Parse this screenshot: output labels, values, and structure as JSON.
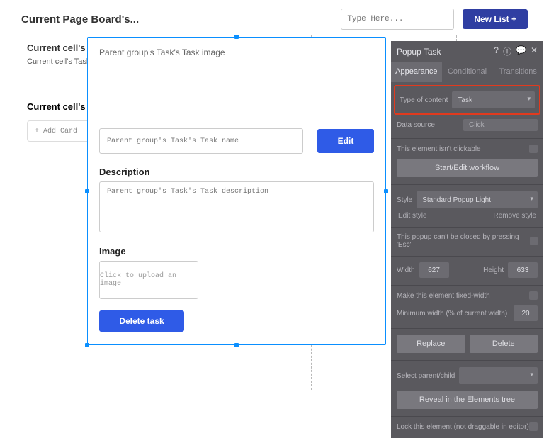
{
  "header": {
    "title": "Current Page Board's...",
    "type_placeholder": "Type Here...",
    "new_list_label": "New List +"
  },
  "board": {
    "col_header": "Current cell's I",
    "task_label": "Current cell's Task",
    "col_sub": "Current cell's",
    "add_card": "+ Add Card"
  },
  "popup": {
    "image_label": "Parent group's Task's Task image",
    "name_placeholder": "Parent group's Task's Task name",
    "edit_label": "Edit",
    "desc_heading": "Description",
    "desc_placeholder": "Parent group's Task's Task description",
    "image_heading": "Image",
    "image_upload": "Click to upload an image",
    "delete_label": "Delete task"
  },
  "inspector": {
    "title": "Popup Task",
    "tabs": {
      "appearance": "Appearance",
      "conditional": "Conditional",
      "transitions": "Transitions"
    },
    "type_of_content_label": "Type of content",
    "type_of_content_value": "Task",
    "data_source_label": "Data source",
    "data_source_value": "Click",
    "not_clickable": "This element isn't clickable",
    "workflow_btn": "Start/Edit workflow",
    "style_label": "Style",
    "style_value": "Standard Popup Light",
    "edit_style": "Edit style",
    "remove_style": "Remove style",
    "esc_note": "This popup can't be closed by pressing 'Esc'",
    "width_label": "Width",
    "width_value": "627",
    "height_label": "Height",
    "height_value": "633",
    "fixed_width": "Make this element fixed-width",
    "min_width_label": "Minimum width (% of current width)",
    "min_width_value": "20",
    "replace": "Replace",
    "delete": "Delete",
    "select_parent": "Select parent/child",
    "reveal": "Reveal in the Elements tree",
    "lock": "Lock this element (not draggable in editor)"
  }
}
